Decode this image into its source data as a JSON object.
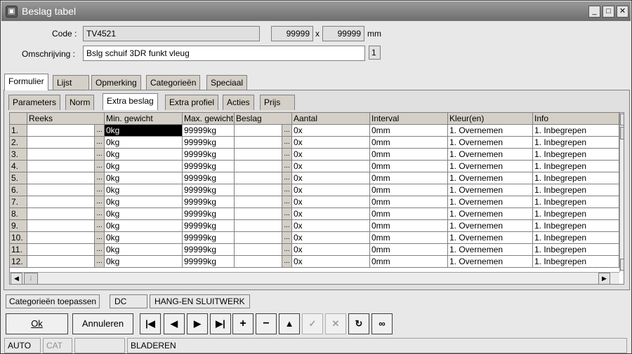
{
  "window": {
    "title": "Beslag tabel",
    "min_label": "_",
    "max_label": "□",
    "close_label": "✕",
    "app_icon": "▣"
  },
  "form": {
    "code_label": "Code :",
    "code_value": "TV4521",
    "width_value": "99999",
    "height_value": "99999",
    "dim_sep": "x",
    "unit": "mm",
    "desc_label": "Omschrijving :",
    "desc_value": "Bslg schuif 3DR funkt vleug",
    "desc_index": "1"
  },
  "main_tabs": [
    "Formulier",
    "Lijst",
    "Opmerking",
    "Categorieën",
    "Speciaal"
  ],
  "sub_tabs": [
    "Parameters",
    "Norm",
    "Extra beslag",
    "Extra profiel",
    "Acties",
    "Prijs"
  ],
  "grid": {
    "headers": [
      "",
      "Reeks",
      "Min. gewicht",
      "Max. gewicht",
      "Beslag",
      "Aantal",
      "Interval",
      "Kleur(en)",
      "Info"
    ],
    "ellipsis": "...",
    "rows": [
      [
        "1.",
        "",
        "0kg",
        "99999kg",
        "",
        "0x",
        "0mm",
        "1. Overnemen",
        "1. Inbegrepen"
      ],
      [
        "2.",
        "",
        "0kg",
        "99999kg",
        "",
        "0x",
        "0mm",
        "1. Overnemen",
        "1. Inbegrepen"
      ],
      [
        "3.",
        "",
        "0kg",
        "99999kg",
        "",
        "0x",
        "0mm",
        "1. Overnemen",
        "1. Inbegrepen"
      ],
      [
        "4.",
        "",
        "0kg",
        "99999kg",
        "",
        "0x",
        "0mm",
        "1. Overnemen",
        "1. Inbegrepen"
      ],
      [
        "5.",
        "",
        "0kg",
        "99999kg",
        "",
        "0x",
        "0mm",
        "1. Overnemen",
        "1. Inbegrepen"
      ],
      [
        "6.",
        "",
        "0kg",
        "99999kg",
        "",
        "0x",
        "0mm",
        "1. Overnemen",
        "1. Inbegrepen"
      ],
      [
        "7.",
        "",
        "0kg",
        "99999kg",
        "",
        "0x",
        "0mm",
        "1. Overnemen",
        "1. Inbegrepen"
      ],
      [
        "8.",
        "",
        "0kg",
        "99999kg",
        "",
        "0x",
        "0mm",
        "1. Overnemen",
        "1. Inbegrepen"
      ],
      [
        "9.",
        "",
        "0kg",
        "99999kg",
        "",
        "0x",
        "0mm",
        "1. Overnemen",
        "1. Inbegrepen"
      ],
      [
        "10.",
        "",
        "0kg",
        "99999kg",
        "",
        "0x",
        "0mm",
        "1. Overnemen",
        "1. Inbegrepen"
      ],
      [
        "11.",
        "",
        "0kg",
        "99999kg",
        "",
        "0x",
        "0mm",
        "1. Overnemen",
        "1. Inbegrepen"
      ],
      [
        "12.",
        "",
        "0kg",
        "99999kg",
        "",
        "0x",
        "0mm",
        "1. Overnemen",
        "1. Inbegrepen"
      ]
    ]
  },
  "categories": {
    "apply_label": "Categorieën toepassen",
    "code": "DC",
    "name": "HANG-EN SLUITWERK"
  },
  "buttons": {
    "ok": "Ok",
    "cancel": "Annuleren",
    "first_icon": "first-record-icon",
    "prev_icon": "previous-record-icon",
    "next_icon": "next-record-icon",
    "last_icon": "last-record-icon",
    "add_icon": "add-icon",
    "remove_icon": "remove-icon",
    "up_icon": "up-icon",
    "confirm_icon": "check-icon",
    "discard_icon": "cross-icon",
    "refresh_icon": "refresh-icon",
    "find_icon": "binoculars-icon"
  },
  "status": {
    "mode": "AUTO",
    "cat": "CAT",
    "state": "BLADEREN"
  }
}
